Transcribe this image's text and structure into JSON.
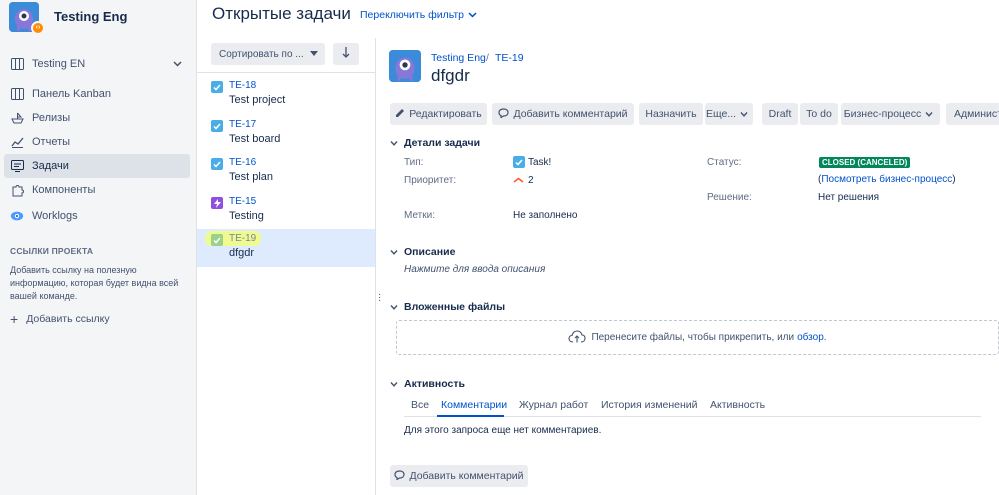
{
  "sidebar": {
    "project_name": "Testing Eng",
    "nav": [
      {
        "label": "Testing EN"
      },
      {
        "label": "Панель Kanban"
      },
      {
        "label": "Релизы"
      },
      {
        "label": "Отчеты"
      },
      {
        "label": "Задачи",
        "active": true
      },
      {
        "label": "Компоненты"
      },
      {
        "label": "Worklogs"
      }
    ],
    "section_title": "ССЫЛКИ ПРОЕКТА",
    "section_desc": "Добавить ссылку на полезную информацию, которая будет видна всей вашей команде.",
    "add_link": "Добавить ссылку"
  },
  "header": {
    "title": "Открытые задачи",
    "switch_filter": "Переключить фильтр"
  },
  "list": {
    "sort_label": "Сортировать по ...",
    "issues": [
      {
        "key": "TE-18",
        "summary": "Test project",
        "type": "task"
      },
      {
        "key": "TE-17",
        "summary": "Test board",
        "type": "task"
      },
      {
        "key": "TE-16",
        "summary": "Test plan",
        "type": "task"
      },
      {
        "key": "TE-15",
        "summary": "Testing",
        "type": "subtask"
      },
      {
        "key": "TE-19",
        "summary": "dfgdr",
        "type": "task",
        "selected": true
      }
    ]
  },
  "issue": {
    "project": "Testing Eng",
    "sep": "/",
    "key": "TE-19",
    "title": "dfgdr",
    "toolbar": {
      "edit": "Редактировать",
      "comment": "Добавить комментарий",
      "assign": "Назначить",
      "more": "Еще...",
      "draft": "Draft",
      "todo": "To do",
      "workflow": "Бизнес-процесс",
      "admin": "Админист"
    },
    "details_title": "Детали задачи",
    "type_label": "Тип:",
    "type_value": "Task!",
    "priority_label": "Приоритет:",
    "priority_value": "2",
    "labels_label": "Метки:",
    "labels_value": "Не заполнено",
    "status_label": "Статус:",
    "status_value": "CLOSED (CANCELED)",
    "wf_open": "(",
    "wf_link": "Посмотреть бизнес-процесс",
    "wf_close": ")",
    "resolution_label": "Решение:",
    "resolution_value": "Нет решения",
    "description_title": "Описание",
    "description_placeholder": "Нажмите для ввода описания",
    "attachments_title": "Вложенные файлы",
    "drop_text": "Перенесите файлы, чтобы прикрепить, или",
    "drop_link": "обзор",
    "drop_dot": ".",
    "activity_title": "Активность",
    "activity_tabs": [
      "Все",
      "Комментарии",
      "Журнал работ",
      "История изменений",
      "Активность"
    ],
    "no_comments": "Для этого запроса еще нет комментариев.",
    "add_comment": "Добавить комментарий"
  },
  "colors": {
    "accent": "#0052cc",
    "status_closed": "#00875a",
    "highlight": "#f4ff73"
  }
}
